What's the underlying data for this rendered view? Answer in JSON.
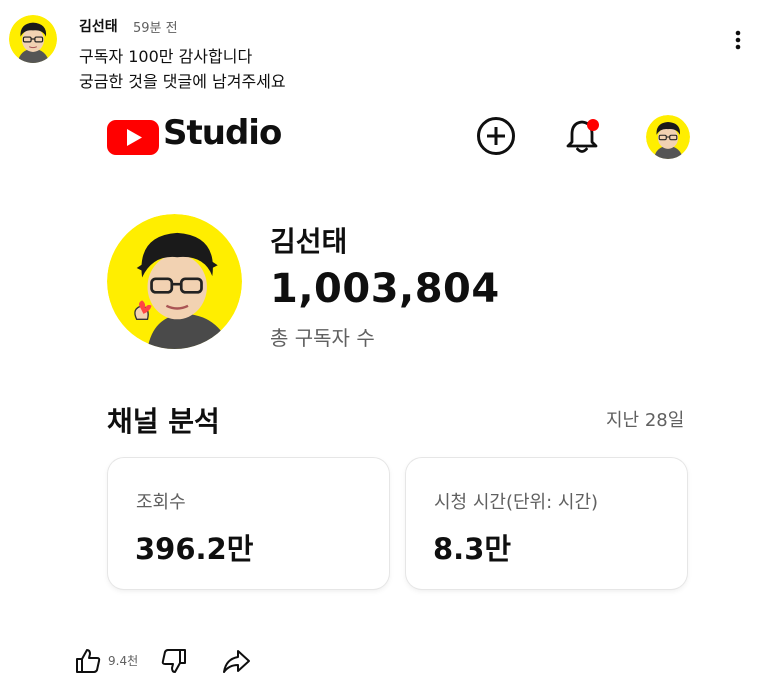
{
  "post": {
    "author": "김선태",
    "time": "59분 전",
    "lines": [
      "구독자 100만 감사합니다",
      "궁금한 것을 댓글에 남겨주세요"
    ]
  },
  "studio": {
    "logo_text": "Studio"
  },
  "channel": {
    "name": "김선태",
    "subscribers": "1,003,804",
    "subscribers_label": "총 구독자 수"
  },
  "analytics": {
    "title": "채널 분석",
    "period": "지난 28일",
    "cards": [
      {
        "label": "조회수",
        "value": "396.2만"
      },
      {
        "label": "시청 시간(단위: 시간)",
        "value": "8.3만"
      }
    ]
  },
  "actions": {
    "like_count": "9.4천"
  },
  "colors": {
    "youtube_red": "#ff0000",
    "avatar_yellow": "#ffee00",
    "notification_dot": "#ff0000"
  },
  "icons": [
    "more-vert-icon",
    "youtube-play-icon",
    "create-plus-icon",
    "bell-icon",
    "thumbs-up-icon",
    "thumbs-down-icon",
    "share-icon"
  ]
}
